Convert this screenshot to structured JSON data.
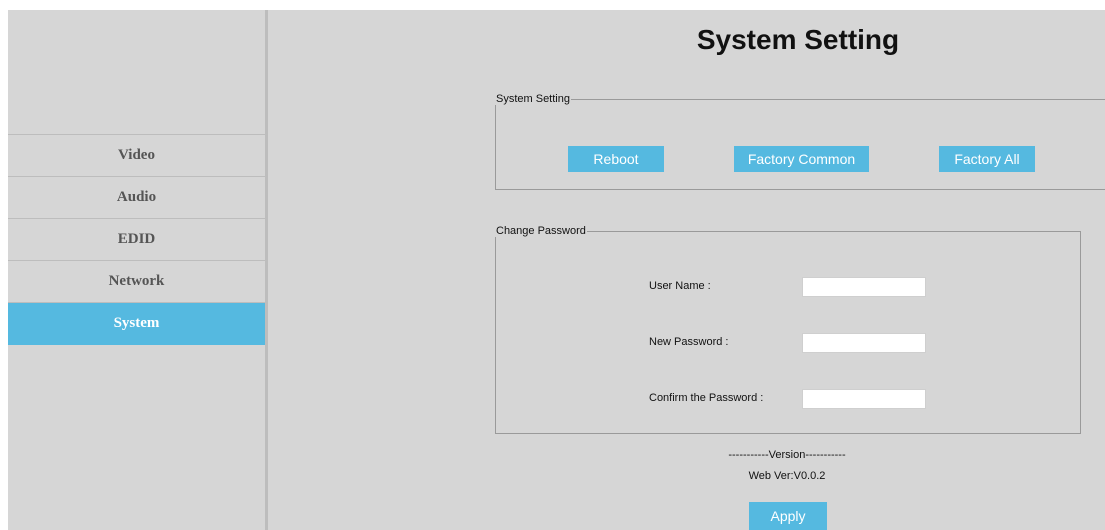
{
  "page": {
    "title": "System Setting"
  },
  "sidebar": {
    "items": [
      {
        "label": "Video",
        "active": false
      },
      {
        "label": "Audio",
        "active": false
      },
      {
        "label": "EDID",
        "active": false
      },
      {
        "label": "Network",
        "active": false
      },
      {
        "label": "System",
        "active": true
      }
    ]
  },
  "system_setting": {
    "legend": "System Setting",
    "reboot_label": "Reboot",
    "factory_common_label": "Factory Common",
    "factory_all_label": "Factory All"
  },
  "change_password": {
    "legend": "Change Password",
    "user_name_label": "User Name :",
    "user_name_value": "",
    "new_password_label": "New Password :",
    "new_password_value": "",
    "confirm_password_label": "Confirm the Password :",
    "confirm_password_value": ""
  },
  "version": {
    "header": "-----------Version-----------",
    "web_ver": "Web Ver:V0.0.2"
  },
  "apply_label": "Apply",
  "colors": {
    "accent": "#55b9e0",
    "background": "#d6d6d6",
    "nav_text": "#555555"
  }
}
